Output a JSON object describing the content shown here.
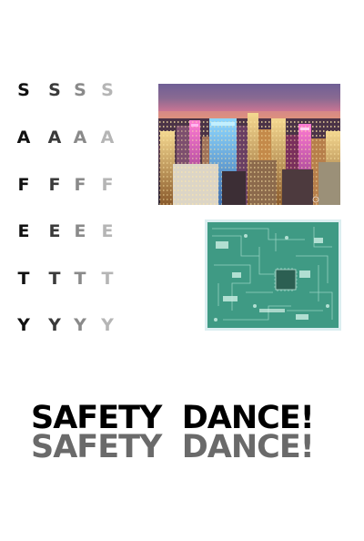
{
  "letters": {
    "rows": [
      [
        "S",
        "S",
        "S",
        "S"
      ],
      [
        "A",
        "A",
        "A",
        "A"
      ],
      [
        "F",
        "F",
        "F",
        "F"
      ],
      [
        "E",
        "E",
        "E",
        "E"
      ],
      [
        "T",
        "T",
        "T",
        "T"
      ],
      [
        "Y",
        "Y",
        "Y",
        "Y"
      ]
    ],
    "colors": [
      "#111111",
      "#3a3a3a",
      "#8a8a8a",
      "#b5b5b5"
    ]
  },
  "images": {
    "city": {
      "icon": "night-city-skyline-photo"
    },
    "board": {
      "icon": "circuit-board-photo",
      "color": "#dbeef0"
    }
  },
  "slogan": {
    "text": "SAFETY  DANCE!",
    "shadow_text": "SAFETY  DANCE!",
    "color": "#000000",
    "shadow_color": "#6a6a6a"
  }
}
